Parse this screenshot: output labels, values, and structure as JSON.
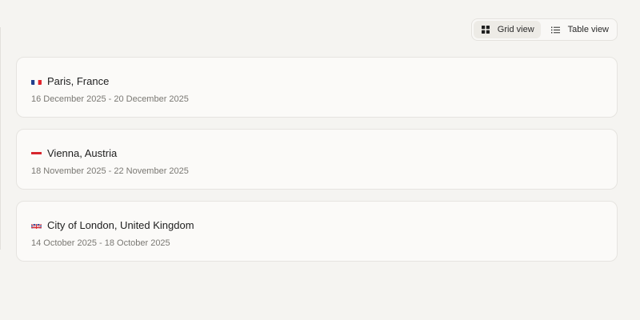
{
  "view_toggle": {
    "grid_label": "Grid view",
    "table_label": "Table view",
    "active": "grid"
  },
  "trips": [
    {
      "flag": "france-flag-icon",
      "location": "Paris, France",
      "dates": "16 December 2025 - 20 December 2025"
    },
    {
      "flag": "austria-flag-icon",
      "location": "Vienna, Austria",
      "dates": "18 November 2025 - 22 November 2025"
    },
    {
      "flag": "uk-flag-icon",
      "location": "City of London, United Kingdom",
      "dates": "14 October 2025 - 18 October 2025"
    }
  ],
  "colors": {
    "background": "#f5f4f1",
    "card": "#fbfaf8",
    "border": "#e6e4e0",
    "muted_text": "#7a7873",
    "active_toggle": "#edebe6"
  }
}
